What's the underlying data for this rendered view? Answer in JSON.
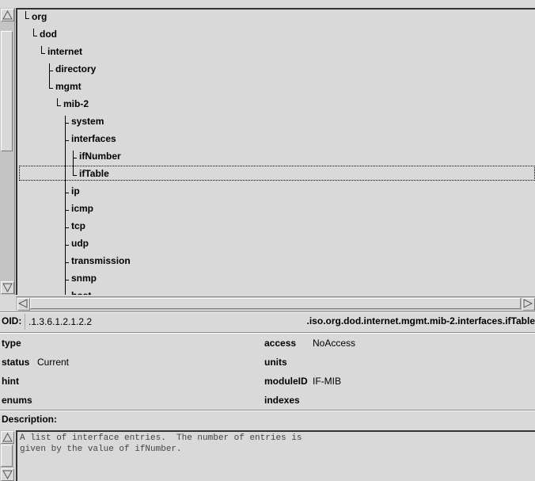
{
  "tree": {
    "selected_index": 7,
    "nodes": [
      {
        "label": "org"
      },
      {
        "label": "dod"
      },
      {
        "label": "internet"
      },
      {
        "label": "directory"
      },
      {
        "label": "mgmt"
      },
      {
        "label": "mib-2"
      },
      {
        "label": "system"
      },
      {
        "label": "interfaces"
      },
      {
        "label": "ifNumber"
      },
      {
        "label": "ifTable"
      },
      {
        "label": "ip"
      },
      {
        "label": "icmp"
      },
      {
        "label": "tcp"
      },
      {
        "label": "udp"
      },
      {
        "label": "transmission"
      },
      {
        "label": "snmp"
      },
      {
        "label": "host"
      }
    ]
  },
  "oid": {
    "label": "OID:",
    "value": ".1.3.6.1.2.1.2.2",
    "path": ".iso.org.dod.internet.mgmt.mib-2.interfaces.ifTable"
  },
  "fields": {
    "type": {
      "label": "type",
      "value": ""
    },
    "access": {
      "label": "access",
      "value": "NoAccess"
    },
    "status": {
      "label": "status",
      "value": "Current"
    },
    "units": {
      "label": "units",
      "value": ""
    },
    "hint": {
      "label": "hint",
      "value": ""
    },
    "moduleID": {
      "label": "moduleID",
      "value": "IF-MIB"
    },
    "enums": {
      "label": "enums",
      "value": ""
    },
    "indexes": {
      "label": "indexes",
      "value": ""
    }
  },
  "description": {
    "label": "Description:",
    "text": "A list of interface entries.  The number of entries is\ngiven by the value of ifNumber."
  },
  "icons": {
    "up": "scroll-up-arrow-icon",
    "down": "scroll-down-arrow-icon",
    "left": "scroll-left-arrow-icon",
    "right": "scroll-right-arrow-icon"
  }
}
